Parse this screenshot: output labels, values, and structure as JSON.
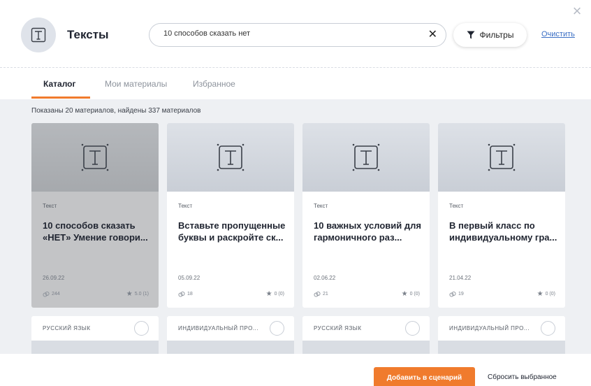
{
  "header": {
    "title": "Тексты",
    "avatar_icon": "text-document-icon"
  },
  "search": {
    "value": "10 способов сказать нет",
    "placeholder": ""
  },
  "filter": {
    "label": "Фильтры",
    "icon": "funnel-icon"
  },
  "clear_link": "Очистить",
  "tabs": [
    {
      "label": "Каталог",
      "active": true
    },
    {
      "label": "Мои материалы",
      "active": false
    },
    {
      "label": "Избранное",
      "active": false
    }
  ],
  "results": {
    "summary": "Показаны 20 материалов, найдены 337 материалов"
  },
  "cards": [
    {
      "type": "Текст",
      "title": "10 способов сказать «НЕТ» Умение говори...",
      "date": "26.09.22",
      "views": "244",
      "rating": "5.0 (1)",
      "selected": true,
      "tag": "РУССКИЙ ЯЗЫК"
    },
    {
      "type": "Текст",
      "title": "Вставьте пропущенные буквы и раскройте ск...",
      "date": "05.09.22",
      "views": "18",
      "rating": "0 (0)",
      "selected": false,
      "tag": "ИНДИВИДУАЛЬНЫЙ ПРО..."
    },
    {
      "type": "Текст",
      "title": "10 важных условий для гармоничного раз...",
      "date": "02.06.22",
      "views": "21",
      "rating": "0 (0)",
      "selected": false,
      "tag": "РУССКИЙ ЯЗЫК"
    },
    {
      "type": "Текст",
      "title": "В первый класс по индивидуальному гра...",
      "date": "21.04.22",
      "views": "19",
      "rating": "0 (0)",
      "selected": false,
      "tag": "ИНДИВИДУАЛЬНЫЙ ПРО..."
    }
  ],
  "footer": {
    "add_label": "Добавить в сценарий",
    "reset_label": "Сбросить выбранное"
  },
  "colors": {
    "accent": "#f07b2d",
    "link": "#3b6fc4",
    "content_bg": "#eef0f3",
    "selected_card": "#c3c4c6"
  }
}
